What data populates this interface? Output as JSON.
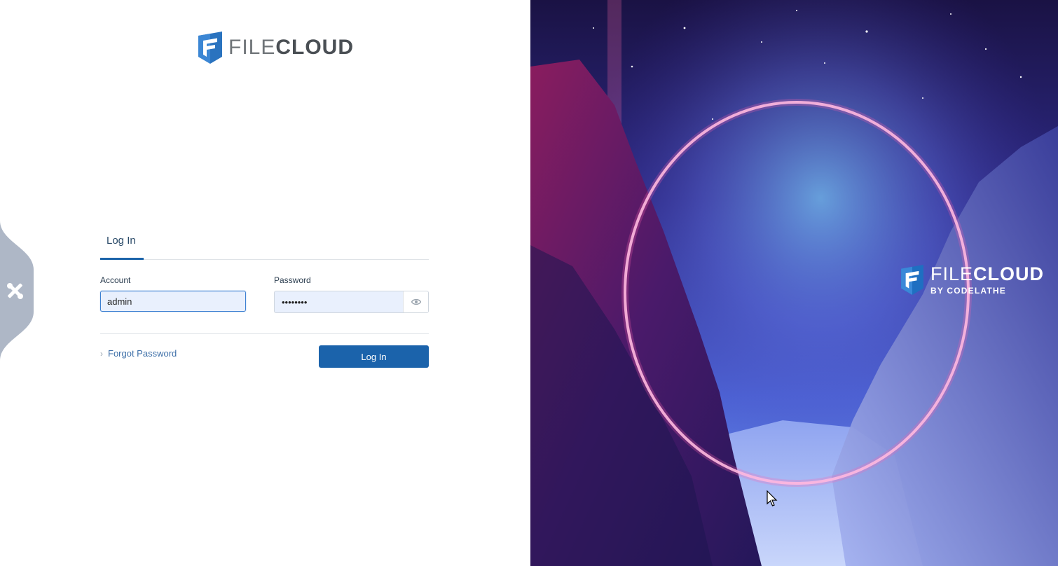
{
  "logo": {
    "text_file": "FILE",
    "text_cloud": "CLOUD"
  },
  "login": {
    "tab_label": "Log In",
    "account_label": "Account",
    "account_value": "admin",
    "password_label": "Password",
    "password_value": "••••••••",
    "forgot_label": "Forgot Password",
    "submit_label": "Log In"
  },
  "brand": {
    "text_file": "FILE",
    "text_cloud": "CLOUD",
    "subtitle": "BY CODELATHE"
  },
  "colors": {
    "accent": "#1b63ab",
    "input_bg": "#e9f0fd",
    "side_tab": "#aeb7c6"
  },
  "icons": {
    "side_tab": "tools-icon",
    "password_toggle": "eye-icon",
    "forgot_chevron": "chevron-right-icon"
  }
}
